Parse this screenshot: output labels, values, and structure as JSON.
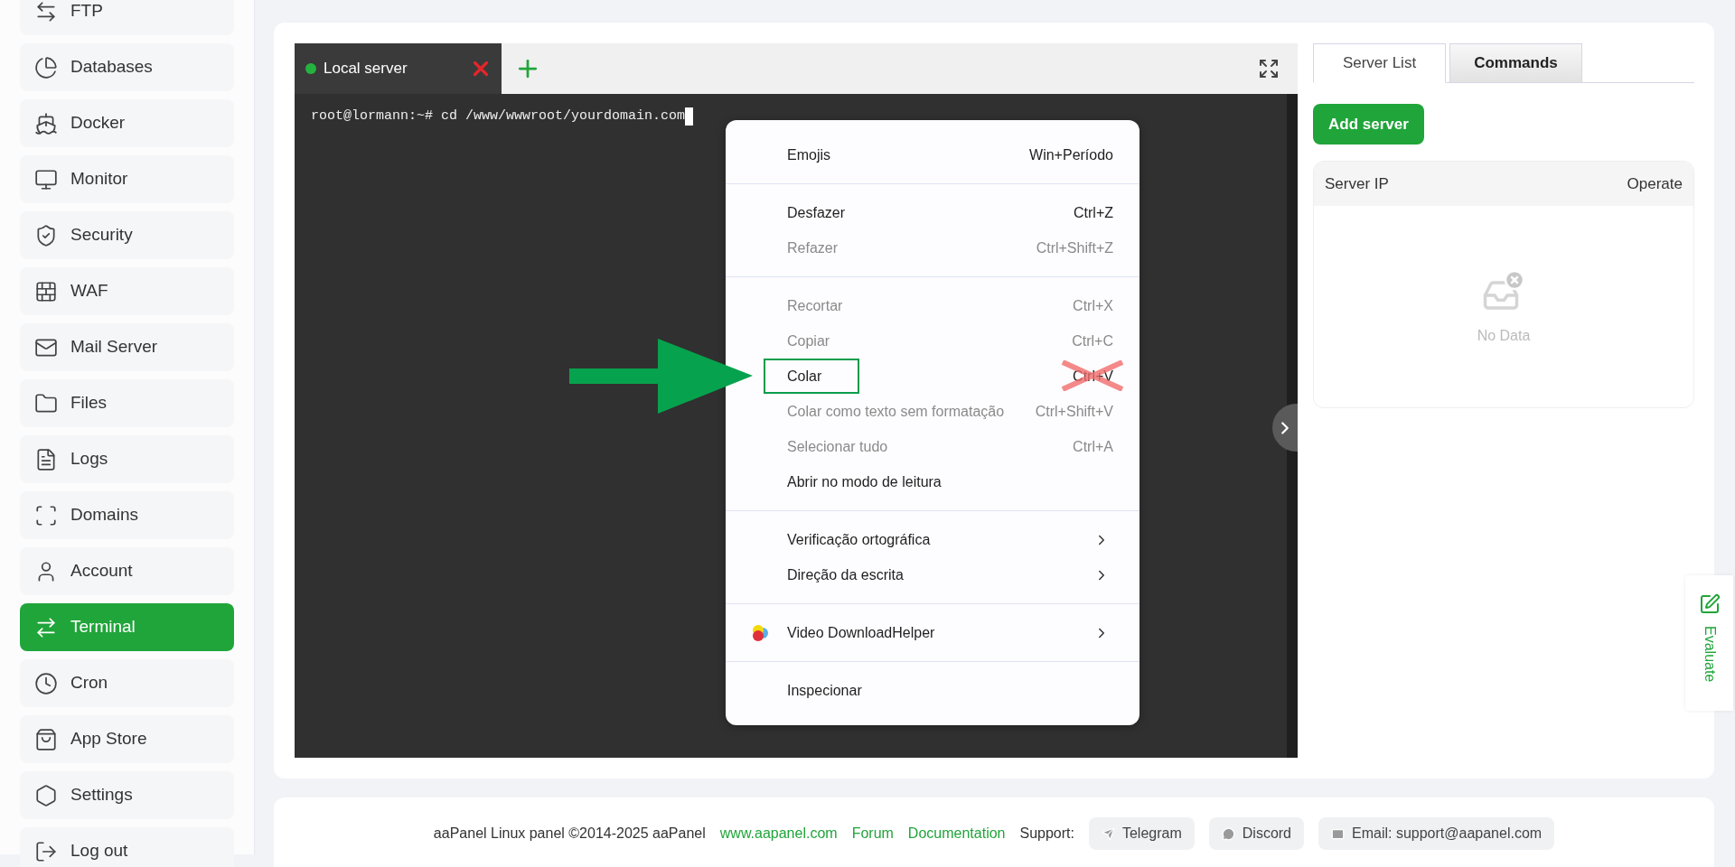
{
  "sidebar": {
    "items": [
      {
        "label": "FTP",
        "selected": false
      },
      {
        "label": "Databases",
        "selected": false
      },
      {
        "label": "Docker",
        "selected": false
      },
      {
        "label": "Monitor",
        "selected": false
      },
      {
        "label": "Security",
        "selected": false
      },
      {
        "label": "WAF",
        "selected": false
      },
      {
        "label": "Mail Server",
        "selected": false
      },
      {
        "label": "Files",
        "selected": false
      },
      {
        "label": "Logs",
        "selected": false
      },
      {
        "label": "Domains",
        "selected": false
      },
      {
        "label": "Account",
        "selected": false
      },
      {
        "label": "Terminal",
        "selected": true
      },
      {
        "label": "Cron",
        "selected": false
      },
      {
        "label": "App Store",
        "selected": false
      },
      {
        "label": "Settings",
        "selected": false
      },
      {
        "label": "Log out",
        "selected": false
      }
    ]
  },
  "terminal": {
    "tabs": [
      {
        "label": "Local server",
        "selected": true
      }
    ],
    "lines": [
      "root@lormann:~# cd /www/wwwroot/yourdomain.com"
    ]
  },
  "context_menu": {
    "groups": [
      {
        "items": [
          {
            "label": "Emojis",
            "shortcut": "Win+Período",
            "kind": "action",
            "disabled": false,
            "boxed": false,
            "shortcut_crossed": false
          }
        ]
      },
      {
        "items": [
          {
            "label": "Desfazer",
            "shortcut": "Ctrl+Z",
            "kind": "action",
            "disabled": false,
            "boxed": false,
            "shortcut_crossed": false
          },
          {
            "label": "Refazer",
            "shortcut": "Ctrl+Shift+Z",
            "kind": "action",
            "disabled": true,
            "boxed": false,
            "shortcut_crossed": false
          }
        ]
      },
      {
        "items": [
          {
            "label": "Recortar",
            "shortcut": "Ctrl+X",
            "kind": "action",
            "disabled": true,
            "boxed": false,
            "shortcut_crossed": false
          },
          {
            "label": "Copiar",
            "shortcut": "Ctrl+C",
            "kind": "action",
            "disabled": true,
            "boxed": false,
            "shortcut_crossed": false
          },
          {
            "label": "Colar",
            "shortcut": "Ctrl+V",
            "kind": "action",
            "disabled": false,
            "boxed": true,
            "shortcut_crossed": true
          },
          {
            "label": "Colar como texto sem formatação",
            "shortcut": "Ctrl+Shift+V",
            "kind": "action",
            "disabled": true,
            "boxed": false,
            "shortcut_crossed": false
          },
          {
            "label": "Selecionar tudo",
            "shortcut": "Ctrl+A",
            "kind": "action",
            "disabled": true,
            "boxed": false,
            "shortcut_crossed": false
          },
          {
            "label": "Abrir no modo de leitura",
            "kind": "action",
            "disabled": false,
            "boxed": false
          }
        ]
      },
      {
        "items": [
          {
            "label": "Verificação ortográfica",
            "kind": "submenu",
            "disabled": false,
            "boxed": false
          },
          {
            "label": "Direção da escrita",
            "kind": "submenu",
            "disabled": false,
            "boxed": false
          }
        ]
      },
      {
        "items": [
          {
            "label": "Video DownloadHelper",
            "kind": "extension",
            "disabled": false,
            "boxed": false
          }
        ]
      },
      {
        "items": [
          {
            "label": "Inspecionar",
            "kind": "action",
            "disabled": false,
            "boxed": false
          }
        ]
      }
    ]
  },
  "right_panel": {
    "tabs": [
      {
        "label": "Server List",
        "selected": true
      },
      {
        "label": "Commands",
        "selected": false
      }
    ],
    "add_button": "Add server",
    "table": {
      "columns": [
        "Server IP",
        "Operate"
      ],
      "empty_text": "No Data"
    }
  },
  "footer": {
    "copyright": "aaPanel Linux panel ©2014-2025 aaPanel",
    "links": [
      "www.aapanel.com",
      "Forum",
      "Documentation"
    ],
    "support_label": "Support:",
    "support_buttons": [
      "Telegram",
      "Discord",
      "Email: support@aapanel.com"
    ]
  },
  "evaluate": {
    "label": "Evaluate"
  }
}
